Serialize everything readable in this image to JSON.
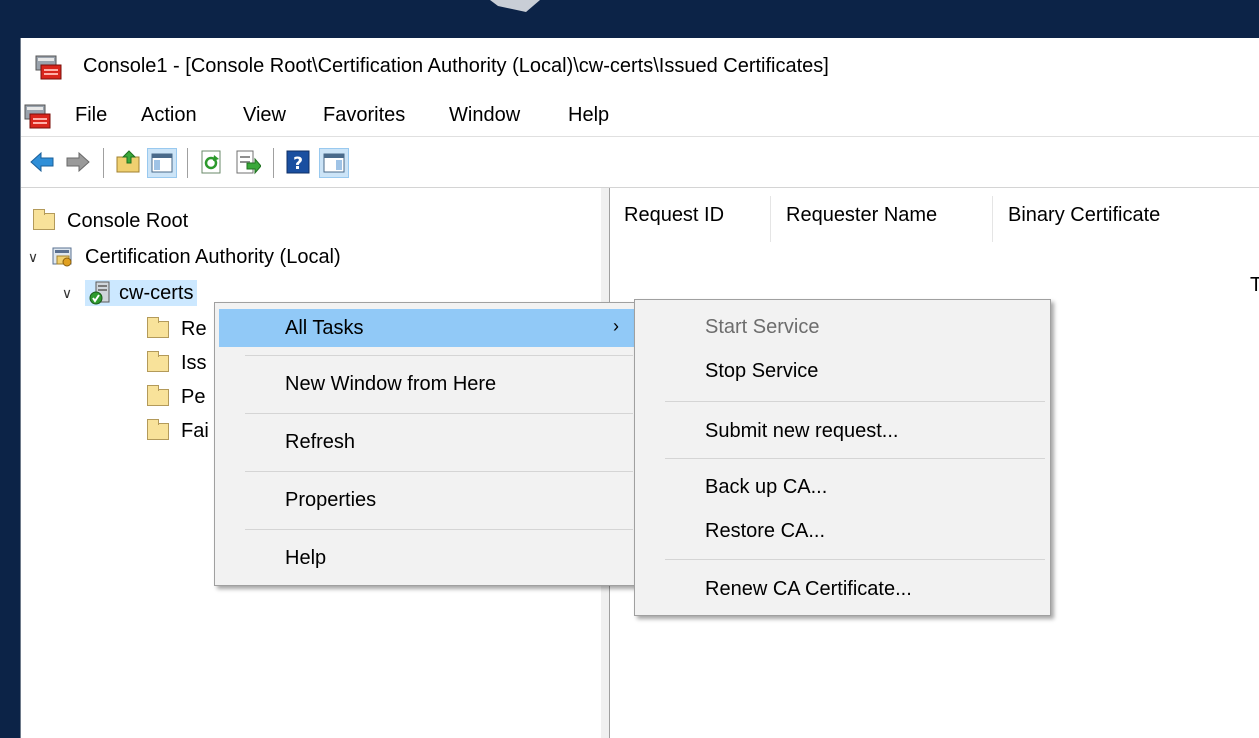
{
  "window": {
    "title": "Console1 - [Console Root\\Certification Authority (Local)\\cw-certs\\Issued Certificates]"
  },
  "menubar": {
    "items": [
      "File",
      "Action",
      "View",
      "Favorites",
      "Window",
      "Help"
    ]
  },
  "toolbar": {
    "icons": [
      "back-icon",
      "forward-icon",
      "up-folder-icon",
      "show-hide-tree-icon",
      "refresh-icon",
      "export-list-icon",
      "help-icon",
      "show-hide-action-pane-icon"
    ]
  },
  "tree": {
    "root": "Console Root",
    "ca": "Certification Authority (Local)",
    "server": "cw-certs",
    "children": [
      "Re",
      "Iss",
      "Pe",
      "Fai"
    ]
  },
  "list": {
    "columns": [
      "Request ID",
      "Requester Name",
      "Binary Certificate"
    ],
    "partial_text": "Th"
  },
  "context_menu": {
    "items": [
      "All Tasks",
      "New Window from Here",
      "Refresh",
      "Properties",
      "Help"
    ],
    "submenu_arrow": "›"
  },
  "submenu": {
    "items": [
      "Start Service",
      "Stop Service",
      "Submit new request...",
      "Back up CA...",
      "Restore CA...",
      "Renew CA Certificate..."
    ]
  },
  "colors": {
    "desktop": "#0c2347",
    "menu_highlight": "#91c9f7",
    "menu_background": "#f2f2f2",
    "tree_selection": "#cce8ff"
  }
}
